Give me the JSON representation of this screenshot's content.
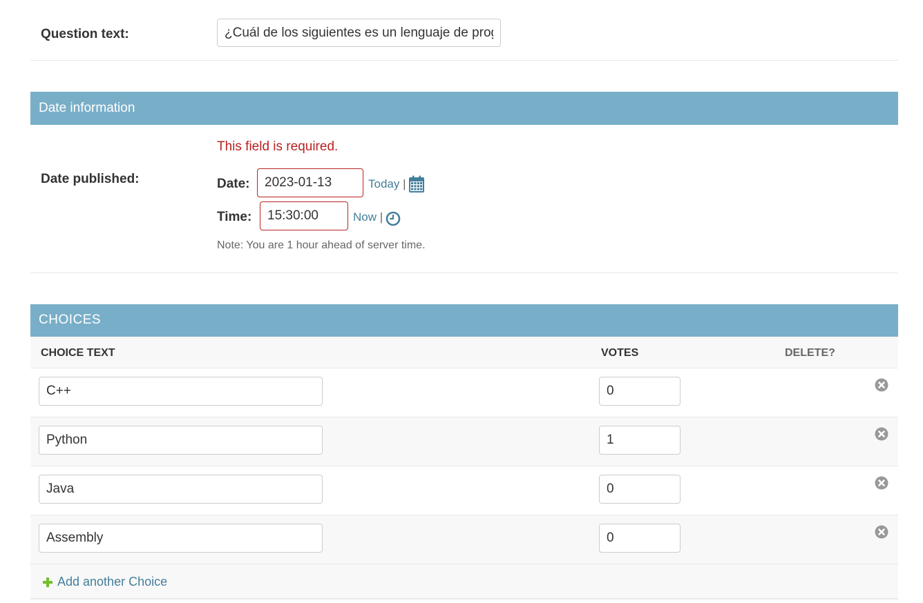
{
  "question": {
    "label": "Question text:",
    "value": "¿Cuál de los siguientes es un lenguaje de programación?"
  },
  "date_info": {
    "header": "Date information",
    "label": "Date published:",
    "error": "This field is required.",
    "date_label": "Date:",
    "date_value": "2023-01-13",
    "today_link": "Today",
    "time_label": "Time:",
    "time_value": "15:30:00",
    "now_link": "Now",
    "separator": "|",
    "note": "Note: You are 1 hour ahead of server time."
  },
  "choices": {
    "header": "CHOICES",
    "columns": {
      "choice_text": "CHOICE TEXT",
      "votes": "VOTES",
      "delete": "DELETE?"
    },
    "rows": [
      {
        "choice_text": "C++",
        "votes": "0"
      },
      {
        "choice_text": "Python",
        "votes": "1"
      },
      {
        "choice_text": "Java",
        "votes": "0"
      },
      {
        "choice_text": "Assembly",
        "votes": "0"
      }
    ],
    "add_label": "Add another Choice"
  },
  "icons": {
    "calendar": "calendar-icon",
    "clock": "clock-icon",
    "delete": "delete-icon",
    "add": "plus-icon"
  },
  "colors": {
    "header_bg": "#79aec8",
    "link": "#447e9b",
    "error": "#ba2121",
    "add_green": "#70bf2b"
  }
}
